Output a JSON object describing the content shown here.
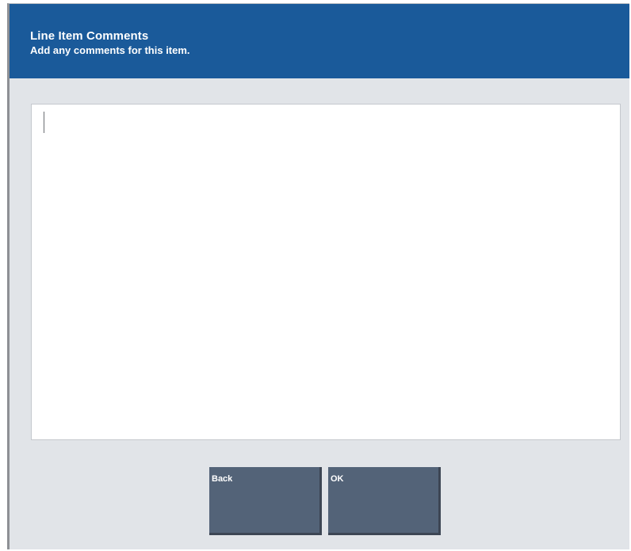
{
  "header": {
    "title": "Line Item Comments",
    "subtitle": "Add any comments for this item."
  },
  "comment": {
    "value": ""
  },
  "buttons": {
    "back_label": "Back",
    "ok_label": "OK"
  },
  "colors": {
    "header_bg": "#1a5a9a",
    "dialog_bg": "#e1e4e8",
    "button_bg": "#536378"
  }
}
